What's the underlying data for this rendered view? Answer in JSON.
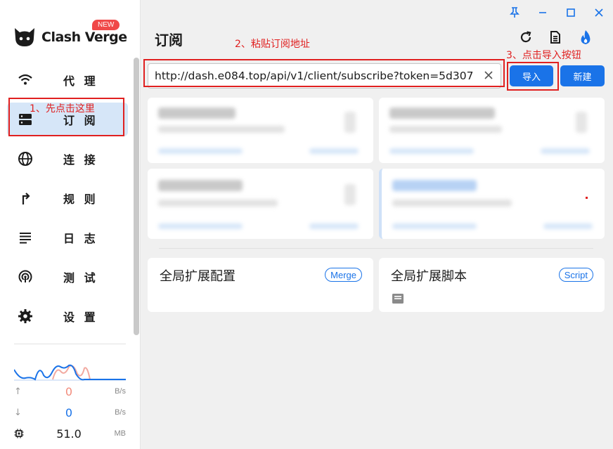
{
  "app": {
    "name": "Clash Verge",
    "badge": "NEW"
  },
  "sidebar": {
    "items": [
      {
        "label": "代 理",
        "icon": "wifi-icon"
      },
      {
        "label": "订 阅",
        "icon": "server-icon"
      },
      {
        "label": "连 接",
        "icon": "globe-icon"
      },
      {
        "label": "规 则",
        "icon": "route-icon"
      },
      {
        "label": "日 志",
        "icon": "list-icon"
      },
      {
        "label": "测 试",
        "icon": "signal-icon"
      },
      {
        "label": "设 置",
        "icon": "gear-icon"
      }
    ],
    "active_index": 1
  },
  "traffic": {
    "upload_value": "0",
    "upload_unit": "B/s",
    "download_value": "0",
    "download_unit": "B/s",
    "memory_value": "51.0",
    "memory_unit": "MB"
  },
  "page": {
    "title": "订阅"
  },
  "subscribe": {
    "url_value": "http://dash.e084.top/api/v1/client/subscribe?token=5d307",
    "import_label": "导入",
    "new_label": "新建"
  },
  "extensions": [
    {
      "title": "全局扩展配置",
      "chip": "Merge"
    },
    {
      "title": "全局扩展脚本",
      "chip": "Script"
    }
  ],
  "annotations": {
    "step1": "1、先点击这里",
    "step2": "2、粘贴订阅地址",
    "step3": "3、点击导入按钮"
  },
  "colors": {
    "accent": "#1a73e8",
    "annotation": "#e02020",
    "active_nav": "#d6e6f8",
    "badge": "#f04848"
  }
}
